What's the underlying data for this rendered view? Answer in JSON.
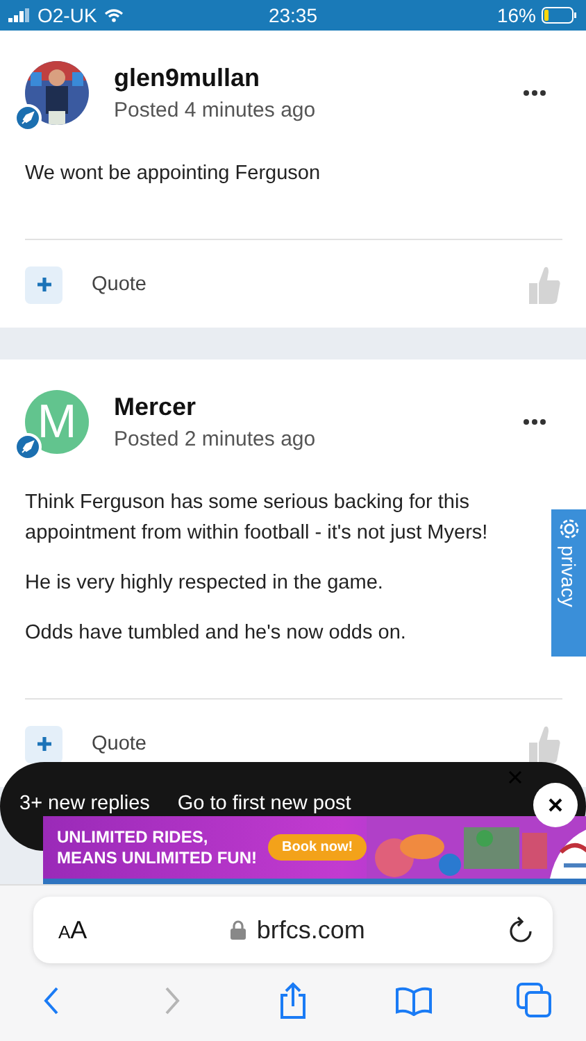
{
  "status_bar": {
    "carrier": "O2-UK",
    "time": "23:35",
    "battery": "16%"
  },
  "posts": [
    {
      "author": "glen9mullan",
      "avatar": {
        "kind": "picture"
      },
      "posted": "Posted 4 minutes ago",
      "paragraphs": [
        "We wont be appointing Ferguson"
      ],
      "quote": "Quote"
    },
    {
      "author": "Mercer",
      "avatar": {
        "kind": "letter",
        "letter": "M",
        "color": "#62c48e"
      },
      "posted": "Posted 2 minutes ago",
      "paragraphs": [
        "Think Ferguson has some serious backing for this appointment from within football - it's not just Myers!",
        "He is very highly respected in the game.",
        "Odds have tumbled and he's now odds on."
      ],
      "quote": "Quote"
    }
  ],
  "privacy_tab": {
    "label": "privacy"
  },
  "new_replies_bar": {
    "count": "3+ new replies",
    "link": "Go to first new post"
  },
  "ad": {
    "headline": [
      "UNLIMITED RIDES,",
      "MEANS UNLIMITED FUN!"
    ],
    "button": "Book now!"
  },
  "browser": {
    "text_size": "AA",
    "url": "brfcs.com",
    "back_enabled": true,
    "forward_enabled": false
  }
}
